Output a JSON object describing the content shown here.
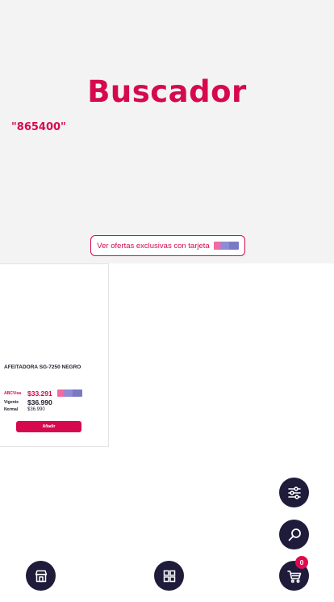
{
  "hero": {
    "title": "Buscador",
    "query": "\"865400\"",
    "offers_button_label": "Ver ofertas exclusivas con tarjeta"
  },
  "product": {
    "name": "AFEITADORA SG-7250 NEGRO",
    "prices": {
      "abc_label": "ABCVisa",
      "abc_value": "$33.291",
      "vigente_label": "Vigente",
      "vigente_value": "$36.990",
      "normal_label": "Normal",
      "normal_value": "$36.990"
    },
    "add_button_label": "Añadir"
  },
  "cart": {
    "count": "0"
  },
  "icons": {
    "filter": "sliders-icon",
    "search": "search-icon",
    "store": "store-icon",
    "grid": "grid-icon",
    "cart": "cart-icon",
    "card": "credit-card-logo-icon"
  },
  "colors": {
    "accent": "#d6094f",
    "fab_background": "#1f1b3b",
    "hero_background": "#f3f3f4",
    "badge": "#e0094f"
  }
}
